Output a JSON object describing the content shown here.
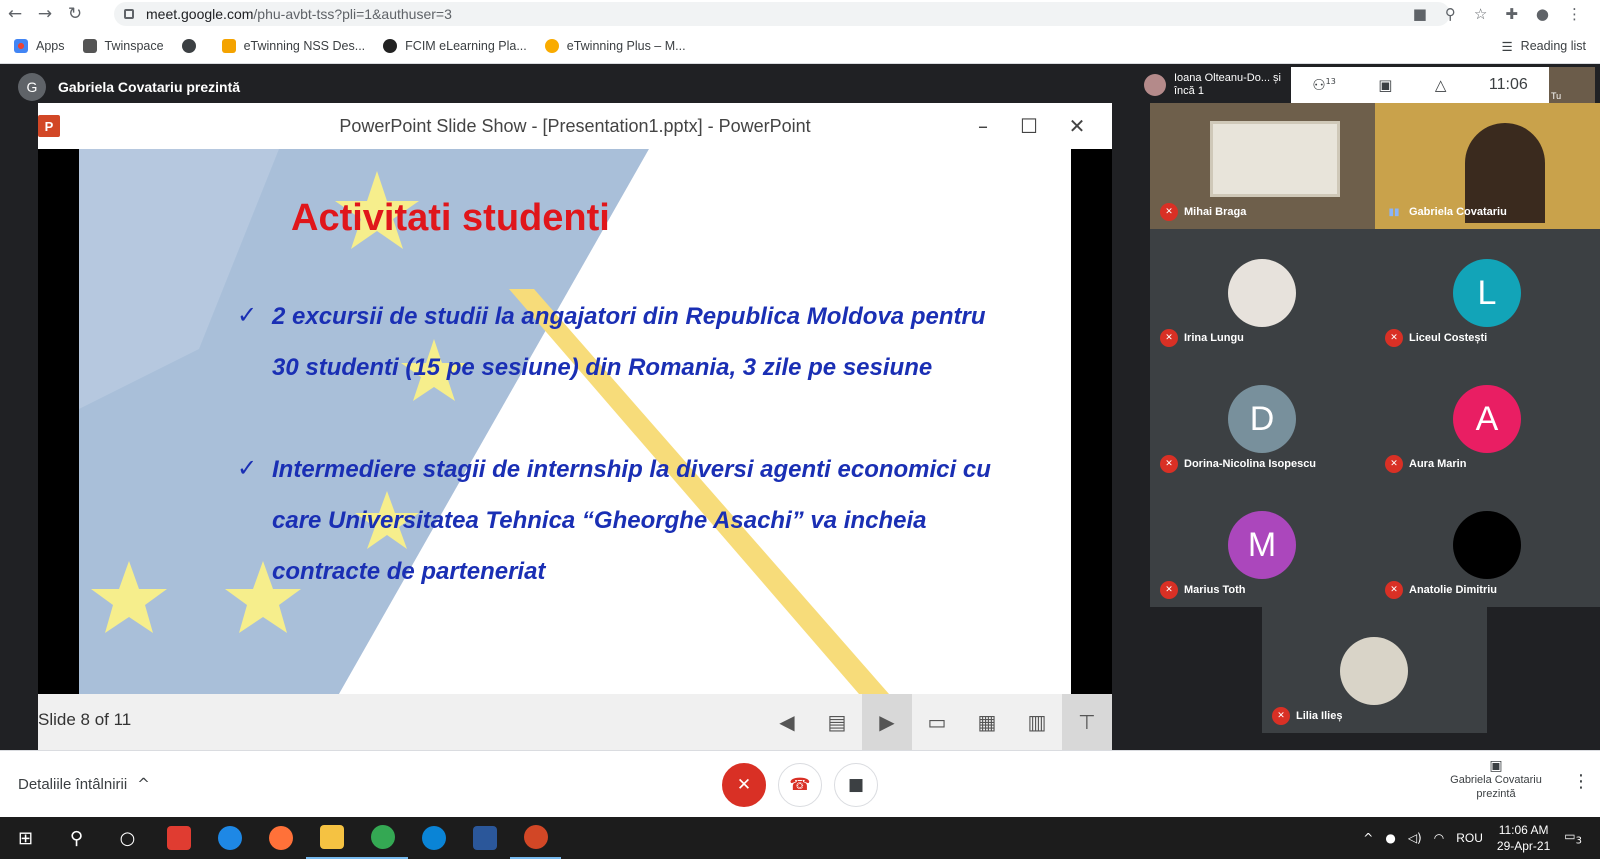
{
  "browser": {
    "url_host": "meet.google.com",
    "url_path": "/phu-avbt-tss?pli=1&authuser=3",
    "reading_list": "Reading list",
    "bookmarks": [
      {
        "label": "Apps",
        "color": "#4285f4"
      },
      {
        "label": "Twinspace",
        "color": "#555555"
      },
      {
        "label": "",
        "color": "#3c4043"
      },
      {
        "label": "eTwinning NSS Des...",
        "color": "#f4a300"
      },
      {
        "label": "FCIM eLearning Pla...",
        "color": "#222222"
      },
      {
        "label": "eTwinning Plus – M...",
        "color": "#f9ab00"
      }
    ]
  },
  "meet": {
    "presenter_initial": "G",
    "presenter_label": "Gabriela Covatariu prezintă",
    "pinned_name": "Ioana Olteanu-Do... și încă 1",
    "people_count": "13",
    "clock": "11:06",
    "self_label": "Tu",
    "participants": [
      {
        "name": "Mihai Braga",
        "initial": "",
        "color": "#7a6a55",
        "muted": true
      },
      {
        "name": "Gabriela Covatariu",
        "initial": "",
        "color": "#c9a24b",
        "muted": false
      },
      {
        "name": "Irina Lungu",
        "initial": "",
        "color": "#e7e2dc",
        "muted": true
      },
      {
        "name": "Liceul Costești",
        "initial": "L",
        "color": "#12a4b8",
        "muted": true
      },
      {
        "name": "Dorina-Nicolina Isopescu",
        "initial": "D",
        "color": "#78909c",
        "muted": true
      },
      {
        "name": "Aura Marin",
        "initial": "A",
        "color": "#e91e63",
        "muted": true
      },
      {
        "name": "Marius Toth",
        "initial": "M",
        "color": "#ab47bc",
        "muted": true
      },
      {
        "name": "Anatolie Dimitriu",
        "initial": "",
        "color": "#000000",
        "muted": true
      },
      {
        "name": "Lilia Ilieș",
        "initial": "",
        "color": "#d9d4c8",
        "muted": true
      }
    ],
    "meeting_details": "Detaliile întâlnirii",
    "presenting_label": "Gabriela Covatariu prezintă"
  },
  "powerpoint": {
    "window_title": "PowerPoint Slide Show - [Presentation1.pptx] - PowerPoint",
    "slide_counter": "Slide 8 of 11",
    "slide_title": "Activitati studenti",
    "bullet1_line1": "2 excursii de studii la angajatori din Republica Moldova pentru",
    "bullet1_line2": "30 studenti (15 pe sesiune) din Romania, 3 zile pe sesiune",
    "bullet2_line1": "Intermediere stagii de internship la diversi agenti economici cu",
    "bullet2_line2": "care Universitatea Tehnica “Gheorghe Asachi” va incheia",
    "bullet2_line3": "contracte de parteneriat"
  },
  "taskbar": {
    "language": "ROU",
    "time": "11:06 AM",
    "date": "29-Apr-21",
    "notifications": "3"
  }
}
